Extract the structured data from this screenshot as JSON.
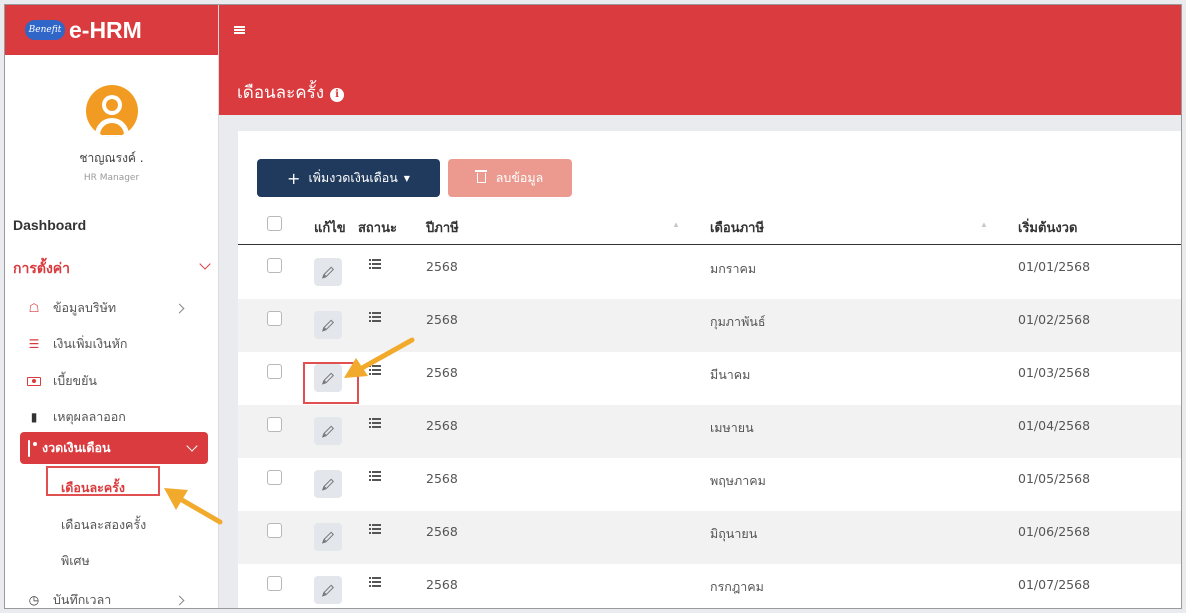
{
  "brand": {
    "logo_text": "Benefit",
    "name": "e-HRM"
  },
  "user": {
    "name": "ชาญณรงค์ .",
    "role": "HR Manager"
  },
  "nav": {
    "dashboard": "Dashboard",
    "settings": "การตั้งค่า",
    "items": [
      {
        "label": "ข้อมูลบริษัท",
        "icon": "home-icon",
        "has_children": true
      },
      {
        "label": "เงินเพิ่มเงินหัก",
        "icon": "list-icon",
        "has_children": false
      },
      {
        "label": "เบี้ยขยัน",
        "icon": "money-icon",
        "has_children": false
      },
      {
        "label": "เหตุผลลาออก",
        "icon": "document-icon",
        "has_children": false
      }
    ],
    "active_group": "งวดเงินเดือน",
    "sub_items": [
      "เดือนละครั้ง",
      "เดือนละสองครั้ง",
      "พิเศษ"
    ],
    "time_record": "บันทึกเวลา"
  },
  "page": {
    "title": "เดือนละครั้ง"
  },
  "toolbar": {
    "add_label": "เพิ่มงวดเงินเดือน",
    "delete_label": "ลบข้อมูล"
  },
  "table": {
    "headers": {
      "edit": "แก้ไข",
      "status": "สถานะ",
      "tax_year": "ปีภาษี",
      "tax_month": "เดือนภาษี",
      "start": "เริ่มต้นงวด"
    },
    "rows": [
      {
        "year": "2568",
        "month": "มกราคม",
        "start": "01/01/2568"
      },
      {
        "year": "2568",
        "month": "กุมภาพันธ์",
        "start": "01/02/2568"
      },
      {
        "year": "2568",
        "month": "มีนาคม",
        "start": "01/03/2568"
      },
      {
        "year": "2568",
        "month": "เมษายน",
        "start": "01/04/2568"
      },
      {
        "year": "2568",
        "month": "พฤษภาคม",
        "start": "01/05/2568"
      },
      {
        "year": "2568",
        "month": "มิถุนายน",
        "start": "01/06/2568"
      },
      {
        "year": "2568",
        "month": "กรกฎาคม",
        "start": "01/07/2568"
      }
    ]
  },
  "colors": {
    "brand_red": "#d93b3e",
    "navy": "#1f3a5c",
    "salmon": "#ec9a8f",
    "avatar": "#f29b22",
    "annotation": "#f2aa2c"
  }
}
